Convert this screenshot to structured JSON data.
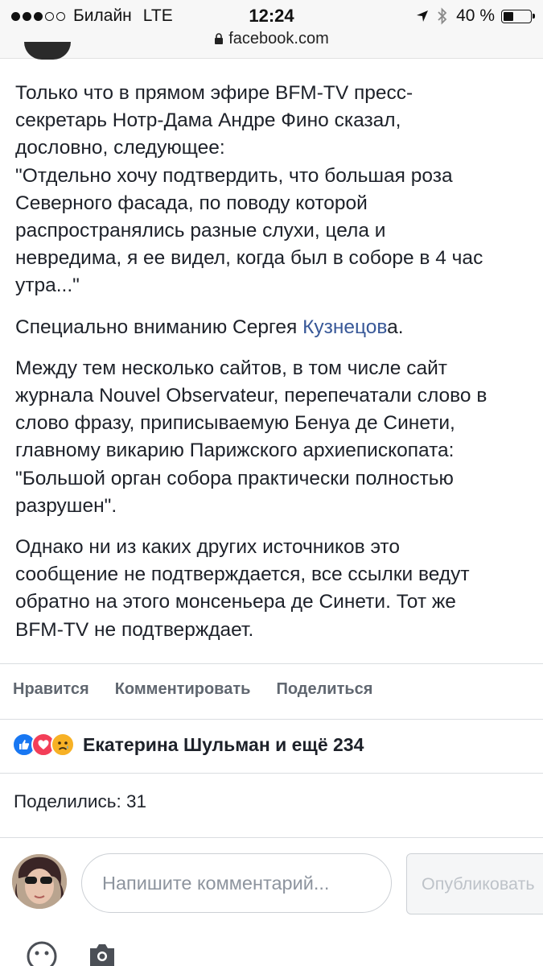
{
  "status_bar": {
    "carrier": "Билайн",
    "network": "LTE",
    "time": "12:24",
    "battery_percent": "40 %",
    "battery_level": 0.4,
    "url": "facebook.com"
  },
  "post": {
    "p1_lines": [
      "Только что в прямом эфире BFM-TV пресс-",
      "секретарь Нотр-Дама Андре Фино сказал,",
      "дословно, следующее:",
      "\"Отдельно хочу подтвердить, что большая роза",
      "Северного фасада, по поводу которой",
      "распространялись разные слухи, цела и",
      "невредима, я ее видел, когда был в соборе в 4 час",
      "утра...\""
    ],
    "p2_before": "Специально вниманию Сергея ",
    "p2_mention": "Кузнецов",
    "p2_after": "а.",
    "p3_lines": [
      "Между тем несколько сайтов, в том числе сайт",
      "журнала Nouvel Observateur, перепечатали слово в",
      "слово фразу, приписываемую Бенуа де Синети,",
      "главному викарию Парижского архиепископата:",
      "\"Большой орган собора практически полностью",
      "разрушен\"."
    ],
    "p4_lines": [
      "Однако ни из каких других источников это",
      "сообщение не подтверждается, все ссылки ведут",
      "обратно на этого монсеньера де Синети. Тот же",
      "BFM-TV не подтверждает."
    ]
  },
  "actions": {
    "like": "Нравится",
    "comment": "Комментировать",
    "share": "Поделиться"
  },
  "reactions": {
    "summary": "Екатерина Шульман и ещё 234",
    "icons": [
      "like-icon",
      "love-icon",
      "sad-icon"
    ]
  },
  "shares": "Поделились: 31",
  "composer": {
    "placeholder": "Напишите комментарий...",
    "publish": "Опубликовать"
  },
  "colors": {
    "mention": "#385898",
    "like_blue": "#1877f2",
    "love_red": "#f33e58",
    "sad_yellow": "#f7b125"
  }
}
